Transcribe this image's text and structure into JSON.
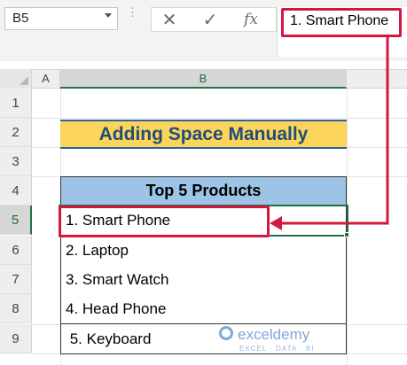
{
  "name_box": {
    "value": "B5"
  },
  "formula_bar": {
    "cancel_icon": "✕",
    "enter_icon": "✓",
    "fx_label": "fx",
    "content": "1. Smart Phone"
  },
  "columns": [
    "A",
    "B"
  ],
  "rows": [
    "1",
    "2",
    "3",
    "4",
    "5",
    "6",
    "7",
    "8",
    "9"
  ],
  "sheet": {
    "title": "Adding Space Manually",
    "table_header": "Top 5 Products",
    "items": [
      "1. Smart Phone",
      "2. Laptop",
      "3. Smart Watch",
      "4. Head Phone",
      " 5. Keyboard"
    ]
  },
  "watermark": {
    "name": "exceldemy",
    "tagline": "EXCEL · DATA · BI"
  },
  "colors": {
    "highlight_red": "#d1193f",
    "excel_green": "#217346",
    "title_fill": "#fcd459",
    "header_fill": "#9dc3e6"
  }
}
